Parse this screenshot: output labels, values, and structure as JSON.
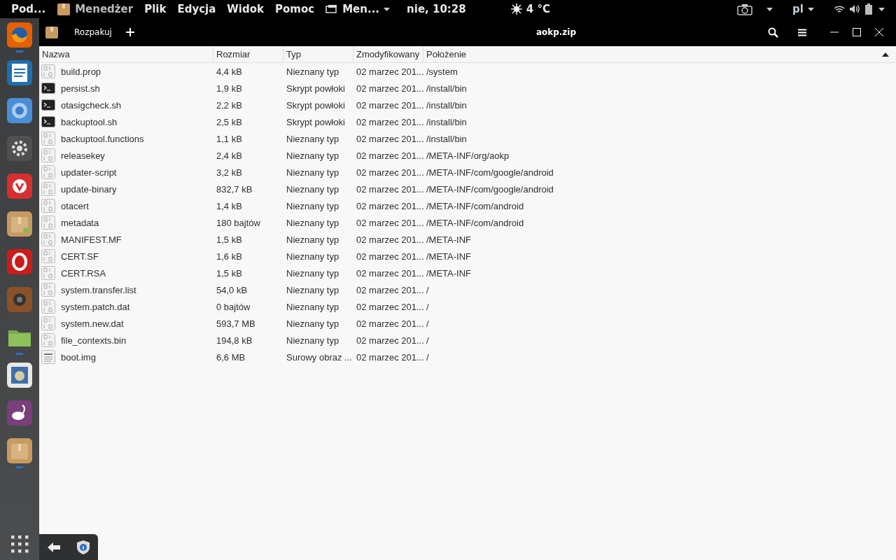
{
  "top_panel": {
    "activities": "Pod...",
    "app_name": "Menedżer",
    "menu": [
      "Plik",
      "Edycja",
      "Widok",
      "Pomoc"
    ],
    "window_menu": "Men...",
    "clock": "nie, 10:28",
    "weather": "4 °C",
    "keyboard": "pl"
  },
  "dock": {
    "items": [
      {
        "kind": "firefox",
        "running": true
      },
      {
        "kind": "writer",
        "running": false
      },
      {
        "kind": "chromium",
        "running": false
      },
      {
        "kind": "settings",
        "running": false
      },
      {
        "kind": "vivaldi",
        "running": false
      },
      {
        "kind": "archive-badge",
        "running": false
      },
      {
        "kind": "opera",
        "running": false
      },
      {
        "kind": "speaker",
        "running": false
      },
      {
        "kind": "folder",
        "running": true
      },
      {
        "kind": "mail",
        "running": false
      },
      {
        "kind": "fish",
        "running": false
      },
      {
        "kind": "archive",
        "running": true
      }
    ]
  },
  "window": {
    "title": "aokp.zip",
    "extract_button": "Rozpakuj"
  },
  "table": {
    "columns": [
      "Nazwa",
      "Rozmiar",
      "Typ",
      "Zmodyfikowany",
      "Położenie"
    ],
    "rows": [
      {
        "kind": "binary",
        "name": "build.prop",
        "size": "4,4 kB",
        "type": "Nieznany typ",
        "modified": "02 marzec 201...",
        "location": "/system"
      },
      {
        "kind": "script",
        "name": "persist.sh",
        "size": "1,9 kB",
        "type": "Skrypt powłoki",
        "modified": "02 marzec 201...",
        "location": "/install/bin"
      },
      {
        "kind": "script",
        "name": "otasigcheck.sh",
        "size": "2,2 kB",
        "type": "Skrypt powłoki",
        "modified": "02 marzec 201...",
        "location": "/install/bin"
      },
      {
        "kind": "script",
        "name": "backuptool.sh",
        "size": "2,5 kB",
        "type": "Skrypt powłoki",
        "modified": "02 marzec 201...",
        "location": "/install/bin"
      },
      {
        "kind": "binary",
        "name": "backuptool.functions",
        "size": "1,1 kB",
        "type": "Nieznany typ",
        "modified": "02 marzec 201...",
        "location": "/install/bin"
      },
      {
        "kind": "binary",
        "name": "releasekey",
        "size": "2,4 kB",
        "type": "Nieznany typ",
        "modified": "02 marzec 201...",
        "location": "/META-INF/org/aokp"
      },
      {
        "kind": "binary",
        "name": "updater-script",
        "size": "3,2 kB",
        "type": "Nieznany typ",
        "modified": "02 marzec 201...",
        "location": "/META-INF/com/google/android"
      },
      {
        "kind": "binary",
        "name": "update-binary",
        "size": "832,7 kB",
        "type": "Nieznany typ",
        "modified": "02 marzec 201...",
        "location": "/META-INF/com/google/android"
      },
      {
        "kind": "binary",
        "name": "otacert",
        "size": "1,4 kB",
        "type": "Nieznany typ",
        "modified": "02 marzec 201...",
        "location": "/META-INF/com/android"
      },
      {
        "kind": "binary",
        "name": "metadata",
        "size": "180 bajtów",
        "type": "Nieznany typ",
        "modified": "02 marzec 201...",
        "location": "/META-INF/com/android"
      },
      {
        "kind": "binary",
        "name": "MANIFEST.MF",
        "size": "1,5 kB",
        "type": "Nieznany typ",
        "modified": "02 marzec 201...",
        "location": "/META-INF"
      },
      {
        "kind": "binary",
        "name": "CERT.SF",
        "size": "1,6 kB",
        "type": "Nieznany typ",
        "modified": "02 marzec 201...",
        "location": "/META-INF"
      },
      {
        "kind": "binary",
        "name": "CERT.RSA",
        "size": "1,5 kB",
        "type": "Nieznany typ",
        "modified": "02 marzec 201...",
        "location": "/META-INF"
      },
      {
        "kind": "binary",
        "name": "system.transfer.list",
        "size": "54,0 kB",
        "type": "Nieznany typ",
        "modified": "02 marzec 201...",
        "location": "/"
      },
      {
        "kind": "binary",
        "name": "system.patch.dat",
        "size": "0 bajtów",
        "type": "Nieznany typ",
        "modified": "02 marzec 201...",
        "location": "/"
      },
      {
        "kind": "binary",
        "name": "system.new.dat",
        "size": "593,7 MB",
        "type": "Nieznany typ",
        "modified": "02 marzec 201...",
        "location": "/"
      },
      {
        "kind": "binary",
        "name": "file_contexts.bin",
        "size": "194,8 kB",
        "type": "Nieznany typ",
        "modified": "02 marzec 201...",
        "location": "/"
      },
      {
        "kind": "text",
        "name": "boot.img",
        "size": "6,6 MB",
        "type": "Surowy obraz ...",
        "modified": "02 marzec 201...",
        "location": "/"
      }
    ]
  }
}
